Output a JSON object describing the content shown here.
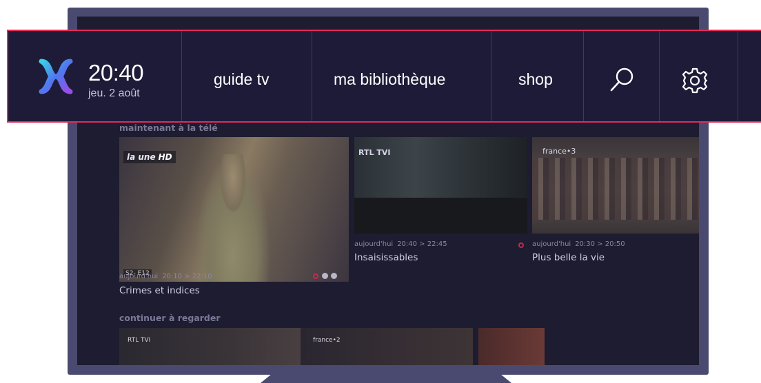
{
  "header": {
    "time": "20:40",
    "date": "jeu. 2 août",
    "nav": [
      "guide tv",
      "ma bibliothèque",
      "shop"
    ],
    "icons": [
      "search-icon",
      "gear-icon"
    ],
    "accent_color": "#e6285c"
  },
  "live_section": {
    "title": "maintenant à la télé",
    "items": [
      {
        "channel": "la une",
        "channel_suffix": "HD",
        "episode": "S2- E12",
        "day": "aujourd'hui",
        "time": "20:10 > 22:10",
        "title": "Crimes et indices"
      },
      {
        "channel": "RTL TVI",
        "day": "aujourd'hui",
        "time": "20:40 > 22:45",
        "title": "Insaisissables"
      },
      {
        "channel": "france•3",
        "day": "aujourd'hui",
        "time": "20:30 > 20:50",
        "title": "Plus belle la vie"
      }
    ]
  },
  "continue_section": {
    "title": "continuer à regarder",
    "items": [
      {
        "channel": "RTL TVI"
      },
      {
        "channel": "france•2"
      },
      {
        "channel": ""
      }
    ]
  }
}
